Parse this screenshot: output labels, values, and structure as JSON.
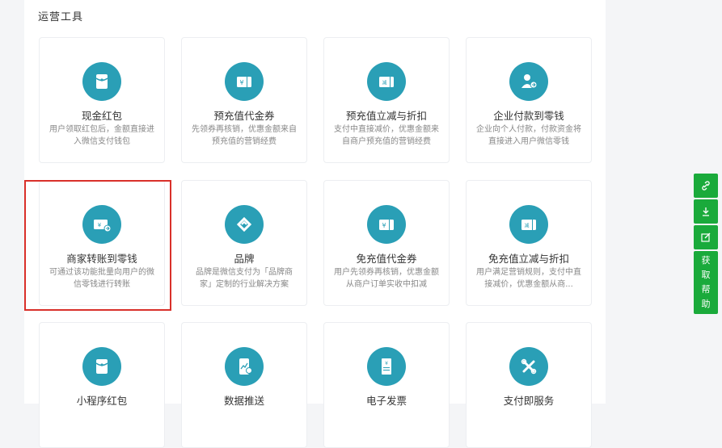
{
  "section": {
    "title": "运营工具"
  },
  "cards": [
    {
      "title": "现金红包",
      "desc": "用户领取红包后，金额直接进入微信支付钱包",
      "icon": "red-packet-icon"
    },
    {
      "title": "预充值代金券",
      "desc": "先领券再核销，优惠金额来自预充值的营销经费",
      "icon": "voucher-icon"
    },
    {
      "title": "预充值立减与折扣",
      "desc": "支付中直接减价，优惠金额来自商户预充值的营销经费",
      "icon": "discount-icon"
    },
    {
      "title": "企业付款到零钱",
      "desc": "企业向个人付款，付款资金将直接进入用户微信零钱",
      "icon": "enterprise-payment-icon"
    },
    {
      "title": "商家转账到零钱",
      "desc": "可通过该功能批量向用户的微信零钱进行转账",
      "icon": "merchant-transfer-icon"
    },
    {
      "title": "品牌",
      "desc": "品牌是微信支付为「品牌商家」定制的行业解决方案",
      "icon": "brand-icon"
    },
    {
      "title": "免充值代金券",
      "desc": "用户先领券再核销，优惠金额从商户订单实收中扣减",
      "icon": "voucher-icon"
    },
    {
      "title": "免充值立减与折扣",
      "desc": "用户满足营销规则，支付中直接减价，优惠金额从商...",
      "icon": "discount-icon"
    },
    {
      "title": "小程序红包",
      "desc": "",
      "icon": "red-packet-icon"
    },
    {
      "title": "数据推送",
      "desc": "",
      "icon": "data-push-icon"
    },
    {
      "title": "电子发票",
      "desc": "",
      "icon": "invoice-icon"
    },
    {
      "title": "支付即服务",
      "desc": "",
      "icon": "payment-service-icon"
    }
  ],
  "side_tools": {
    "buttons": [
      "link-icon",
      "download-icon",
      "edit-icon"
    ],
    "help_label": [
      "获",
      "取",
      "帮",
      "助"
    ]
  },
  "colors": {
    "icon_bg": "#2a9fb6",
    "side_green": "#1aaa3b",
    "highlight_red": "#d9302a"
  }
}
